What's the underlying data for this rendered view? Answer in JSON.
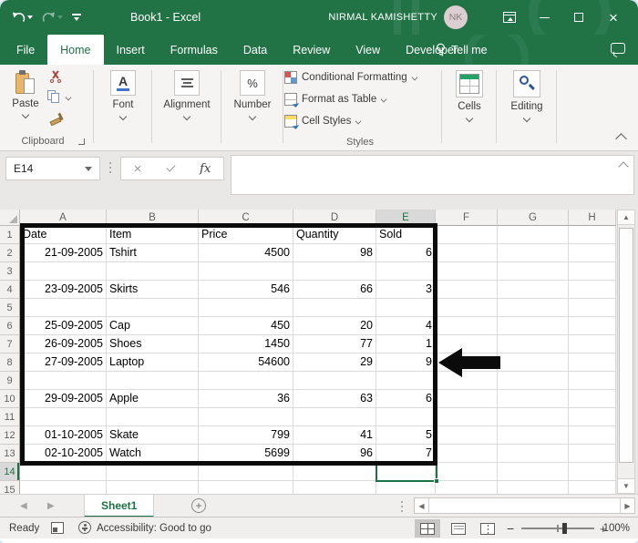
{
  "window": {
    "title": "Book1 - Excel",
    "user_name": "NIRMAL KAMISHETTY",
    "user_initials": "NK"
  },
  "menu_tabs": {
    "items": [
      "File",
      "Home",
      "Insert",
      "Formulas",
      "Data",
      "Review",
      "View",
      "Developer"
    ],
    "active": "Home",
    "tell_me": "Tell me"
  },
  "ribbon": {
    "paste_label": "Paste",
    "font_label": "Font",
    "font_letter": "A",
    "alignment_label": "Alignment",
    "number_label": "Number",
    "number_symbol": "%",
    "styles_items": [
      "Conditional Formatting",
      "Format as Table",
      "Cell Styles"
    ],
    "cells_label": "Cells",
    "editing_label": "Editing",
    "clipboard_group_label": "Clipboard",
    "styles_group_label": "Styles"
  },
  "formula_bar": {
    "name_box": "E14",
    "fx_label": "fx",
    "formula_value": ""
  },
  "grid": {
    "column_headers": [
      "A",
      "B",
      "C",
      "D",
      "E",
      "F",
      "G",
      "H"
    ],
    "row_count": 15,
    "selected_cell": "E14",
    "selected_column": "E",
    "selected_row": 14,
    "cells": [
      [
        "Date",
        "Item",
        "Price",
        "Quantity",
        "Sold"
      ],
      [
        "21-09-2005",
        "Tshirt",
        "4500",
        "98",
        "6"
      ],
      [
        "",
        "",
        "",
        "",
        ""
      ],
      [
        "23-09-2005",
        "Skirts",
        "546",
        "66",
        "3"
      ],
      [
        "",
        "",
        "",
        "",
        ""
      ],
      [
        "25-09-2005",
        "Cap",
        "450",
        "20",
        "4"
      ],
      [
        "26-09-2005",
        "Shoes",
        "1450",
        "77",
        "1"
      ],
      [
        "27-09-2005",
        "Laptop",
        "54600",
        "29",
        "9"
      ],
      [
        "",
        "",
        "",
        "",
        ""
      ],
      [
        "29-09-2005",
        "Apple",
        "36",
        "63",
        "6"
      ],
      [
        "",
        "",
        "",
        "",
        ""
      ],
      [
        "01-10-2005",
        "Skate",
        "799",
        "41",
        "5"
      ],
      [
        "02-10-2005",
        "Watch",
        "5699",
        "96",
        "7"
      ],
      [
        "",
        "",
        "",
        "",
        ""
      ],
      [
        "",
        "",
        "",
        "",
        ""
      ]
    ]
  },
  "sheet_tabs": {
    "active": "Sheet1"
  },
  "status_bar": {
    "mode": "Ready",
    "accessibility": "Accessibility: Good to go",
    "zoom_out": "−",
    "zoom_in": "+",
    "zoom_level": "100%"
  },
  "colors": {
    "excel_green": "#217346",
    "selection_green": "#1e7145",
    "annotation_black": "#0b0b0b"
  }
}
